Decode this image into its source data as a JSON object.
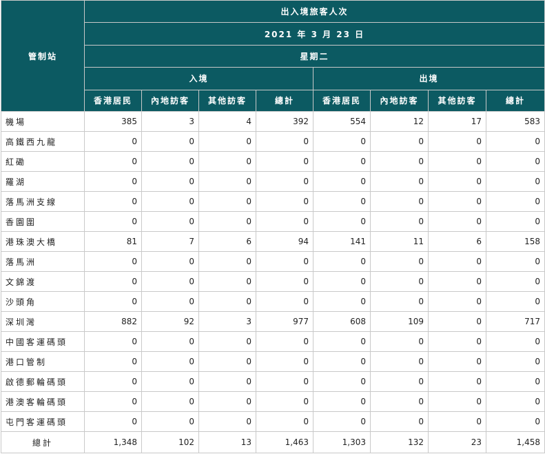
{
  "table": {
    "row_header": "管制站",
    "title": "出入境旅客人次",
    "date": "2021 年 3 月 23 日",
    "weekday": "星期二",
    "groups": [
      "入境",
      "出境"
    ],
    "columns": [
      "香港居民",
      "內地訪客",
      "其他訪客",
      "總計",
      "香港居民",
      "內地訪客",
      "其他訪客",
      "總計"
    ],
    "rows": [
      {
        "station": "機場",
        "values": [
          "385",
          "3",
          "4",
          "392",
          "554",
          "12",
          "17",
          "583"
        ]
      },
      {
        "station": "高鐵西九龍",
        "values": [
          "0",
          "0",
          "0",
          "0",
          "0",
          "0",
          "0",
          "0"
        ]
      },
      {
        "station": "紅磡",
        "values": [
          "0",
          "0",
          "0",
          "0",
          "0",
          "0",
          "0",
          "0"
        ]
      },
      {
        "station": "羅湖",
        "values": [
          "0",
          "0",
          "0",
          "0",
          "0",
          "0",
          "0",
          "0"
        ]
      },
      {
        "station": "落馬洲支線",
        "values": [
          "0",
          "0",
          "0",
          "0",
          "0",
          "0",
          "0",
          "0"
        ]
      },
      {
        "station": "香園圍",
        "values": [
          "0",
          "0",
          "0",
          "0",
          "0",
          "0",
          "0",
          "0"
        ]
      },
      {
        "station": "港珠澳大橋",
        "values": [
          "81",
          "7",
          "6",
          "94",
          "141",
          "11",
          "6",
          "158"
        ]
      },
      {
        "station": "落馬洲",
        "values": [
          "0",
          "0",
          "0",
          "0",
          "0",
          "0",
          "0",
          "0"
        ]
      },
      {
        "station": "文錦渡",
        "values": [
          "0",
          "0",
          "0",
          "0",
          "0",
          "0",
          "0",
          "0"
        ]
      },
      {
        "station": "沙頭角",
        "values": [
          "0",
          "0",
          "0",
          "0",
          "0",
          "0",
          "0",
          "0"
        ]
      },
      {
        "station": "深圳灣",
        "values": [
          "882",
          "92",
          "3",
          "977",
          "608",
          "109",
          "0",
          "717"
        ]
      },
      {
        "station": "中國客運碼頭",
        "values": [
          "0",
          "0",
          "0",
          "0",
          "0",
          "0",
          "0",
          "0"
        ]
      },
      {
        "station": "港口管制",
        "values": [
          "0",
          "0",
          "0",
          "0",
          "0",
          "0",
          "0",
          "0"
        ]
      },
      {
        "station": "啟德郵輪碼頭",
        "values": [
          "0",
          "0",
          "0",
          "0",
          "0",
          "0",
          "0",
          "0"
        ]
      },
      {
        "station": "港澳客輪碼頭",
        "values": [
          "0",
          "0",
          "0",
          "0",
          "0",
          "0",
          "0",
          "0"
        ]
      },
      {
        "station": "屯門客運碼頭",
        "values": [
          "0",
          "0",
          "0",
          "0",
          "0",
          "0",
          "0",
          "0"
        ]
      }
    ],
    "total": {
      "label": "總計",
      "values": [
        "1,348",
        "102",
        "13",
        "1,463",
        "1,303",
        "132",
        "23",
        "1,458"
      ]
    }
  }
}
